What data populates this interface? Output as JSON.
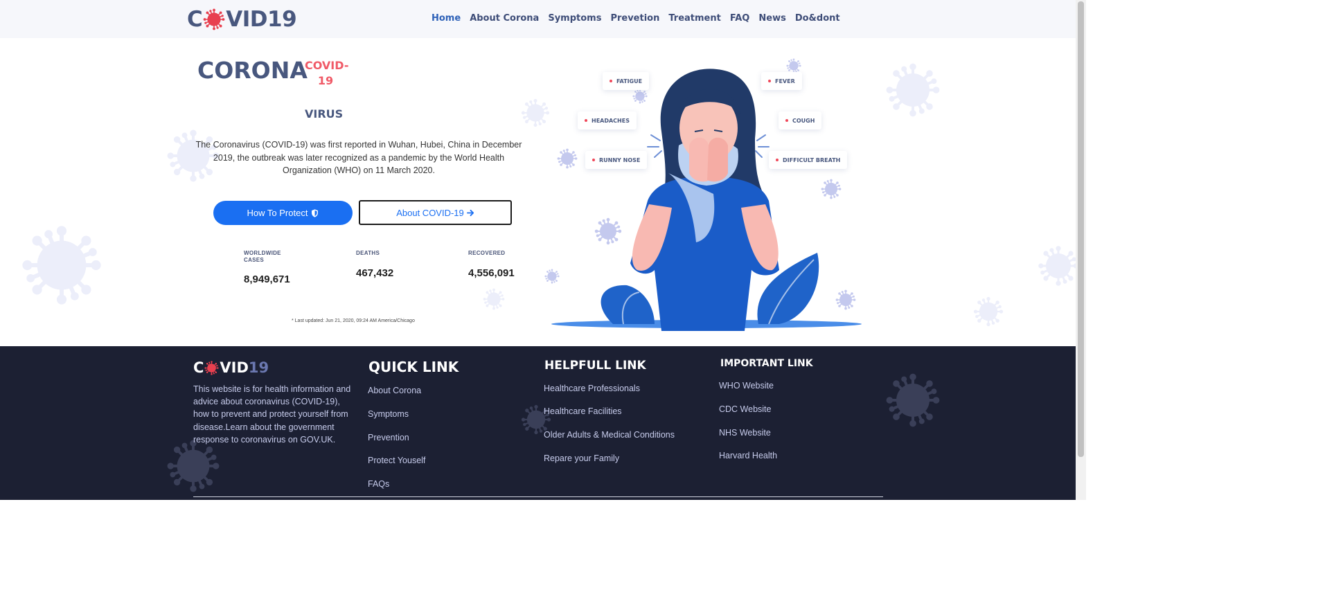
{
  "header": {
    "logo_left": "C",
    "logo_right": "VID19",
    "nav": [
      {
        "label": "Home",
        "active": true
      },
      {
        "label": "About Corona"
      },
      {
        "label": "Symptoms"
      },
      {
        "label": "Prevetion"
      },
      {
        "label": "Treatment"
      },
      {
        "label": "FAQ"
      },
      {
        "label": "News"
      },
      {
        "label": "Do&dont"
      }
    ]
  },
  "hero": {
    "title_main": "CORONA",
    "title_badge": "COVID-19",
    "title_sub": "VIRUS",
    "intro": "The Coronavirus (COVID-19) was first reported in Wuhan, Hubei, China in December 2019, the outbreak was later recognized as a pandemic by the World Health Organization (WHO) on 11 March 2020.",
    "btn_protect": "How To Protect",
    "btn_protect_icon": "shield-icon",
    "btn_about": "About COVID-19",
    "btn_about_icon": "arrow-right-icon",
    "stats": {
      "cases_label": "WORLDWIDE CASES",
      "cases_value": "8,949,671",
      "deaths_label": "DEATHS",
      "deaths_value": "467,432",
      "recovered_label": "RECOVERED",
      "recovered_value": "4,556,091"
    },
    "last_updated": "* Last updated: Jun 21, 2020, 09:24 AM America/Chicago",
    "symptoms": [
      "FATIGUE",
      "FEVER",
      "HEADACHES",
      "COUGH",
      "RUNNY NOSE",
      "DIFFICULT BREATH"
    ]
  },
  "footer": {
    "logo_left": "C",
    "logo_mid": "VID",
    "logo_right": "19",
    "description": "This website is for health information and advice about coronavirus (COVID-19), how to prevent and protect yourself from disease.Learn about the government response to coronavirus on GOV.UK.",
    "quick": {
      "heading": "QUICK LINK",
      "links": [
        "About Corona",
        "Symptoms",
        "Prevention",
        "Protect Youself",
        "FAQs"
      ]
    },
    "helpful": {
      "heading": "HELPFULL LINK",
      "links": [
        "Healthcare Professionals",
        "Healthcare Facilities",
        "Older Adults & Medical Conditions",
        "Repare your Family"
      ]
    },
    "important": {
      "heading": "IMPORTANT LINK",
      "links": [
        "WHO Website",
        "CDC Website",
        "NHS Website",
        "Harvard Health"
      ]
    }
  },
  "colors": {
    "brand_blue": "#48577e",
    "accent_red": "#f05a67",
    "button_blue": "#1a6ff2",
    "footer_bg": "#1c2033"
  }
}
